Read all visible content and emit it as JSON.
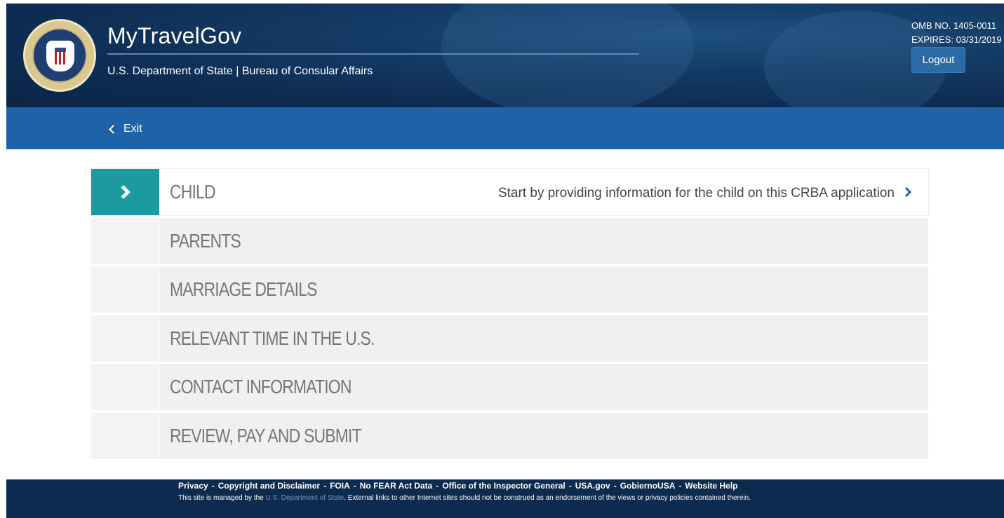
{
  "header": {
    "title": "MyTravelGov",
    "subtitle": "U.S. Department of State | Bureau of Consular Affairs",
    "omb_number": "OMB NO. 1405-0011",
    "expires": "EXPIRES: 03/31/2019",
    "logout_label": "Logout",
    "seal_icon": "state-department-seal"
  },
  "subnav": {
    "exit_label": "Exit",
    "exit_icon": "chevron-left-icon"
  },
  "steps": [
    {
      "label": "CHILD",
      "active": true,
      "hint": "Start by providing information for the child on this CRBA application"
    },
    {
      "label": "PARENTS",
      "active": false
    },
    {
      "label": "MARRIAGE DETAILS",
      "active": false
    },
    {
      "label": "RELEVANT TIME IN THE U.S.",
      "active": false
    },
    {
      "label": "CONTACT INFORMATION",
      "active": false
    },
    {
      "label": "REVIEW, PAY AND SUBMIT",
      "active": false
    }
  ],
  "footer": {
    "links": [
      "Privacy",
      "Copyright and Disclaimer",
      "FOIA",
      "No FEAR Act Data",
      "Office of the Inspector General",
      "USA.gov",
      "GobiernoUSA",
      "Website Help"
    ],
    "separator": "-",
    "note_prefix": "This site is managed by the",
    "note_link": "U.S. Department of State",
    "note_suffix": ". External links to other Internet sites should not be construed as an endorsement of the views or privacy policies contained therein."
  },
  "colors": {
    "header_bg": "#0e2c52",
    "subnav_bg": "#1e62a8",
    "active_step": "#1b9a9f",
    "footer_bg": "#0d2a4f",
    "logout_bg": "#2b6aa5"
  }
}
